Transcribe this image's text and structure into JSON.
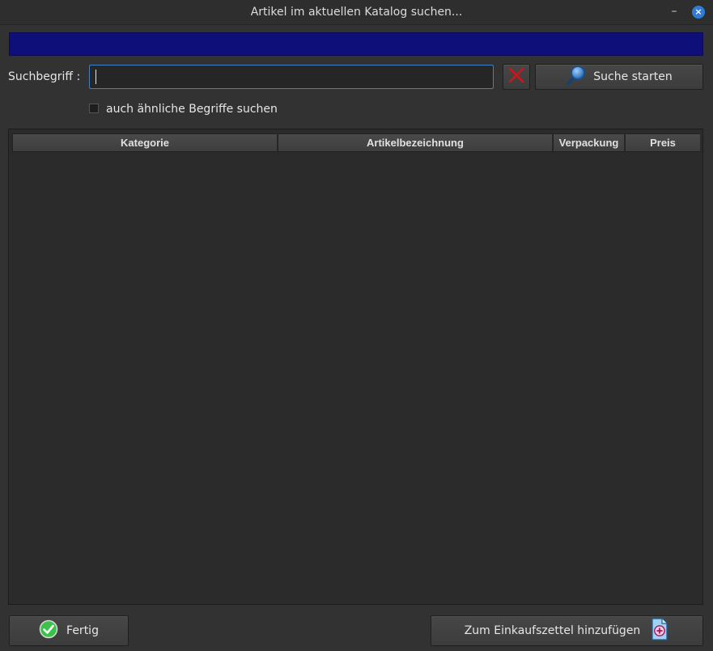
{
  "window": {
    "title": "Artikel im aktuellen Katalog suchen...",
    "minimize_glyph": "–",
    "close_glyph": "×"
  },
  "colors": {
    "background": "#323232",
    "status_bar": "#0f0f7a",
    "input_focus_border": "#3d7fc9",
    "clear_icon": "#d0141b",
    "done_icon": "#3cc24a"
  },
  "search": {
    "label": "Suchbegriff :",
    "value": "",
    "placeholder": "",
    "clear_icon": "red-x-icon",
    "button_label": "Suche starten",
    "button_icon": "magnifier-icon"
  },
  "options": {
    "similar_terms_label": "auch ähnliche Begriffe suchen",
    "similar_terms_checked": false
  },
  "table": {
    "columns": [
      "Kategorie",
      "Artikelbezeichnung",
      "Verpackung",
      "Preis"
    ],
    "rows": []
  },
  "footer": {
    "done_label": "Fertig",
    "done_icon": "green-check-icon",
    "add_label": "Zum Einkaufszettel hinzufügen",
    "add_icon": "document-add-icon"
  }
}
